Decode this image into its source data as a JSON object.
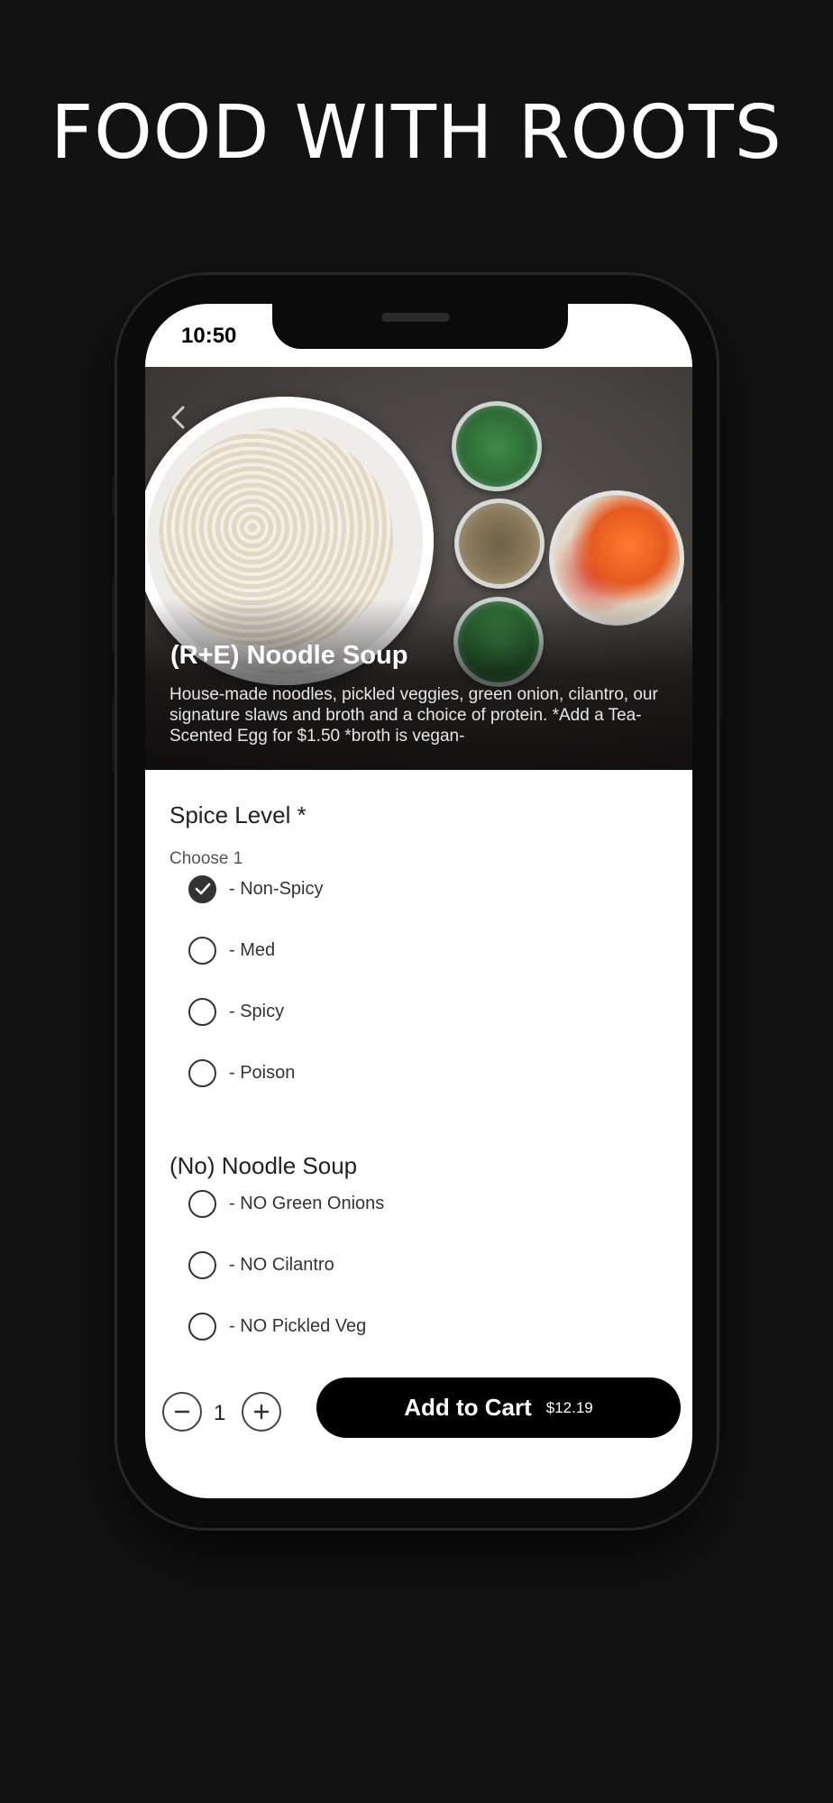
{
  "headline": "FOOD WITH ROOTS",
  "status_bar": {
    "time": "10:50"
  },
  "item": {
    "title": "(R+E) Noodle Soup",
    "description": "House-made noodles, pickled veggies, green onion, cilantro, our signature slaws and broth and a choice of protein. *Add a Tea-Scented Egg for $1.50 *broth is vegan-"
  },
  "spice_section": {
    "title": "Spice Level *",
    "subtitle": "Choose 1",
    "options": [
      {
        "label": "- Non-Spicy",
        "selected": true
      },
      {
        "label": "- Med",
        "selected": false
      },
      {
        "label": "- Spicy",
        "selected": false
      },
      {
        "label": "- Poison",
        "selected": false
      }
    ]
  },
  "noodle_section": {
    "title": "(No) Noodle Soup",
    "options": [
      {
        "label": "- NO Green Onions",
        "selected": false
      },
      {
        "label": "- NO Cilantro",
        "selected": false
      },
      {
        "label": "- NO Pickled Veg",
        "selected": false
      }
    ]
  },
  "cart": {
    "quantity": "1",
    "button_label": "Add to Cart",
    "price": "$12.19"
  },
  "colors": {
    "background": "#121212",
    "button": "#000000",
    "text": "#333333"
  }
}
